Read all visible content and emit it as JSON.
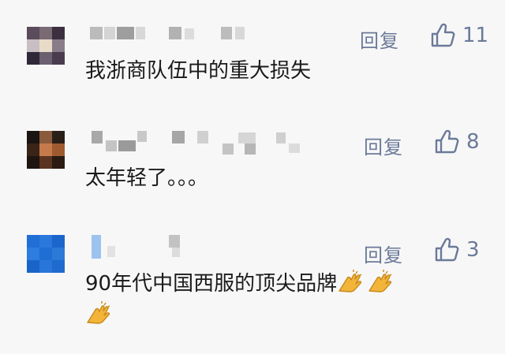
{
  "comments": [
    {
      "reply_label": "回复",
      "like_count": "11",
      "text": "我浙商队伍中的重大损失",
      "avatar_colors": [
        "#5b4c5c",
        "#7a6a73",
        "#3c3040",
        "#c8bfc5",
        "#e8dcc9",
        "#8a7d8a",
        "#2e2838",
        "#6a6070",
        "#4a3c4e"
      ]
    },
    {
      "reply_label": "回复",
      "like_count": "8",
      "text": "太年轻了。。。",
      "avatar_colors": [
        "#1a1412",
        "#8a5a3c",
        "#2a1e18",
        "#3a2418",
        "#c47a4a",
        "#a05a30",
        "#1e1410",
        "#5a3420",
        "#2a1a12"
      ]
    },
    {
      "reply_label": "回复",
      "like_count": "3",
      "text": "90年代中国西服的顶尖品牌",
      "emoji": "clap-hands",
      "avatar_colors": [
        "#1f6fd6",
        "#2a78dc",
        "#1a66cc",
        "#2d7de0",
        "#1f6ed4",
        "#2c7ad8",
        "#1a64c8",
        "#2876da",
        "#1e6ace"
      ]
    }
  ],
  "colors": {
    "background": "#f7f7f7",
    "meta": "#6b7a99",
    "text": "#1a1a1a",
    "clap": "#f2b53a"
  }
}
